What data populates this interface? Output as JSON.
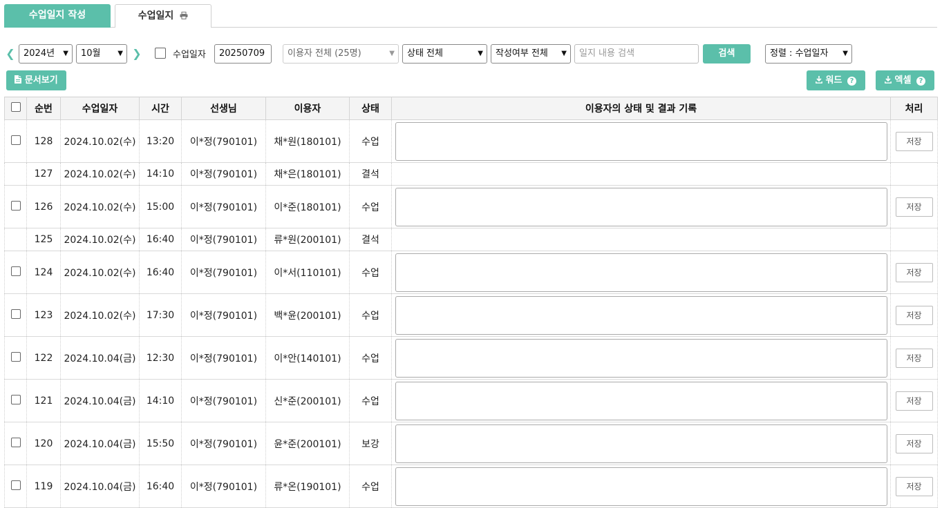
{
  "tabs": {
    "write": "수업일지 작성",
    "journal": "수업일지"
  },
  "filters": {
    "year": "2024년",
    "month": "10월",
    "date_checkbox_label": "수업일자",
    "date_value": "20250709",
    "user_select": "이용자 전체 (25명)",
    "status_select": "상태 전체",
    "written_select": "작성여부 전체",
    "search_placeholder": "일지 내용 검색",
    "search_button": "검색",
    "sort_select": "정렬 : 수업일자"
  },
  "actions": {
    "doc_view": "문서보기",
    "word": "워드",
    "excel": "엑셀",
    "help": "?"
  },
  "table": {
    "headers": [
      "순번",
      "수업일자",
      "시간",
      "선생님",
      "이용자",
      "상태",
      "이용자의 상태 및 결과 기록",
      "처리"
    ],
    "save_label": "저장",
    "rows": [
      {
        "no": "128",
        "date": "2024.10.02(수)",
        "time": "13:20",
        "teacher": "이*정(790101)",
        "user": "채*원(180101)",
        "status": "수업"
      },
      {
        "no": "127",
        "date": "2024.10.02(수)",
        "time": "14:10",
        "teacher": "이*정(790101)",
        "user": "채*은(180101)",
        "status": "결석"
      },
      {
        "no": "126",
        "date": "2024.10.02(수)",
        "time": "15:00",
        "teacher": "이*정(790101)",
        "user": "이*준(180101)",
        "status": "수업"
      },
      {
        "no": "125",
        "date": "2024.10.02(수)",
        "time": "16:40",
        "teacher": "이*정(790101)",
        "user": "류*원(200101)",
        "status": "결석"
      },
      {
        "no": "124",
        "date": "2024.10.02(수)",
        "time": "16:40",
        "teacher": "이*정(790101)",
        "user": "이*서(110101)",
        "status": "수업"
      },
      {
        "no": "123",
        "date": "2024.10.02(수)",
        "time": "17:30",
        "teacher": "이*정(790101)",
        "user": "백*윤(200101)",
        "status": "수업"
      },
      {
        "no": "122",
        "date": "2024.10.04(금)",
        "time": "12:30",
        "teacher": "이*정(790101)",
        "user": "이*안(140101)",
        "status": "수업"
      },
      {
        "no": "121",
        "date": "2024.10.04(금)",
        "time": "14:10",
        "teacher": "이*정(790101)",
        "user": "신*준(200101)",
        "status": "수업"
      },
      {
        "no": "120",
        "date": "2024.10.04(금)",
        "time": "15:50",
        "teacher": "이*정(790101)",
        "user": "윤*준(200101)",
        "status": "보강"
      },
      {
        "no": "119",
        "date": "2024.10.04(금)",
        "time": "16:40",
        "teacher": "이*정(790101)",
        "user": "류*온(190101)",
        "status": "수업"
      }
    ]
  }
}
